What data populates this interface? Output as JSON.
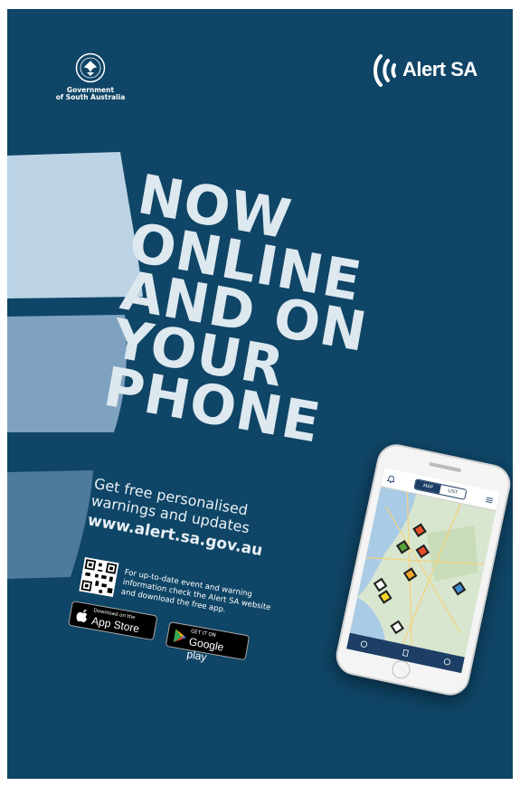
{
  "government": {
    "crest_text": "SOUTH AUSTRALIA",
    "line1": "Government",
    "line2": "of South Australia"
  },
  "alert_logo": {
    "text": "Alert SA"
  },
  "headline": [
    "NOW",
    "ONLINE",
    "AND ON",
    "YOUR",
    "PHONE"
  ],
  "tagline": {
    "line1": "Get free personalised",
    "line2": "warnings and updates",
    "website": "www.alert.sa.gov.au"
  },
  "info": {
    "text": "For up-to-date event and warning information check the Alert SA website and download the free app."
  },
  "badges": {
    "apple_small": "Download on the",
    "apple_big": "App Store",
    "google_small": "GET IT ON",
    "google_big": "Google play"
  },
  "phone_app": {
    "tab_map": "MAP",
    "tab_list": "LIST"
  },
  "colors": {
    "background": "#0f4566",
    "headline": "#dde8ef",
    "wave_top": "#bcd3e6",
    "wave_mid": "#7fa2c0",
    "wave_bottom": "#4e7a9c"
  }
}
